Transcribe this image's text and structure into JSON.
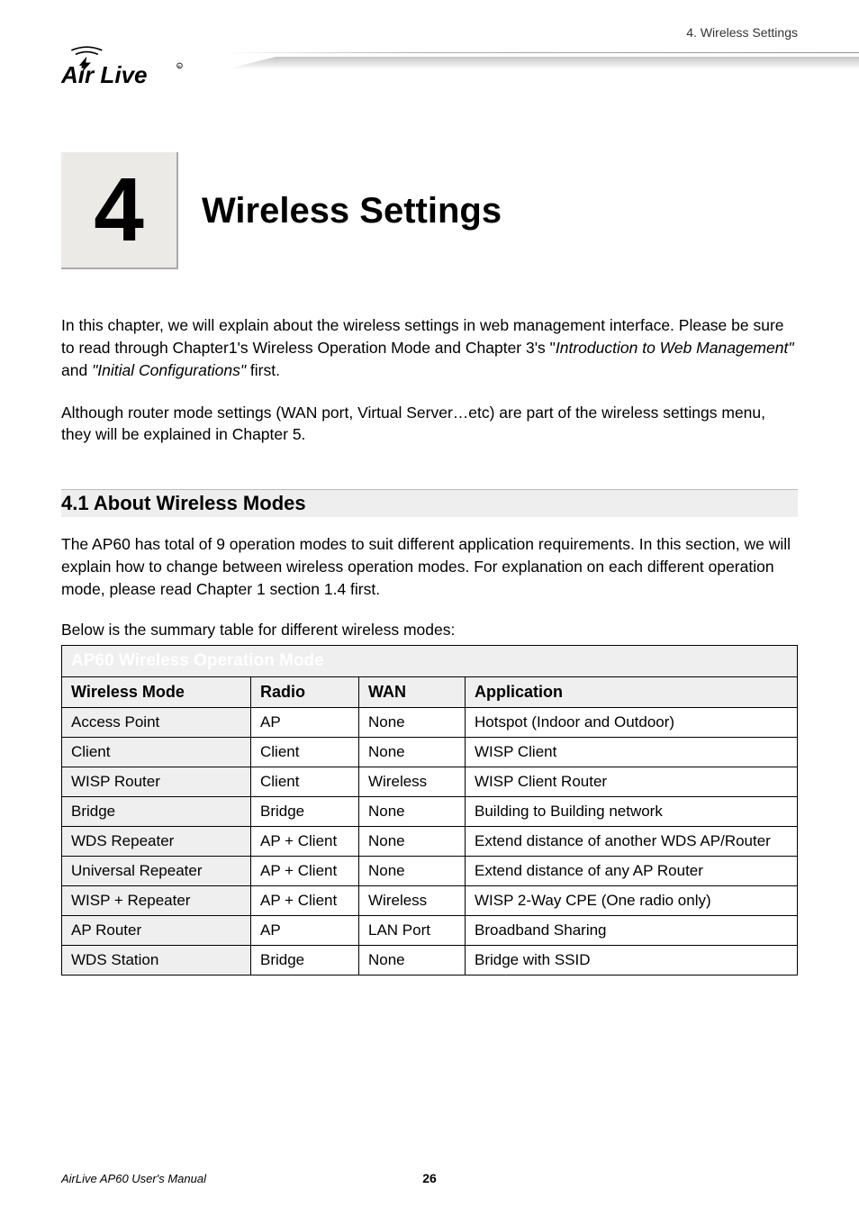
{
  "header": {
    "breadcrumb": "4. Wireless Settings",
    "logo_alt": "Air Live"
  },
  "chapter": {
    "number": "4",
    "title": "Wireless Settings"
  },
  "intro": {
    "p1_a": "In this chapter, we will explain about the wireless settings in web management interface. Please be sure to read through Chapter1's Wireless Operation Mode and Chapter 3's \"",
    "p1_i1": "Introduction to Web Management\"",
    "p1_b": " and ",
    "p1_i2": "\"Initial Configurations\"",
    "p1_c": " first.",
    "p2": "Although router mode settings (WAN port, Virtual Server…etc) are part of the wireless settings menu, they will be explained in Chapter 5."
  },
  "section": {
    "heading": "4.1 About Wireless Modes",
    "p1": "The AP60 has total of 9 operation modes to suit different application requirements.   In this section, we will explain how to change between wireless operation modes.   For explanation on each different operation mode, please read Chapter 1 section 1.4 first.",
    "table_caption": "Below is the summary table for different wireless modes:"
  },
  "table": {
    "title": "AP60 Wireless Operation Mode",
    "headers": {
      "mode": "Wireless Mode",
      "radio": "Radio",
      "wan": "WAN",
      "app": "Application"
    },
    "rows": [
      {
        "mode": "Access Point",
        "radio": "AP",
        "wan": "None",
        "app": "Hotspot (Indoor and Outdoor)"
      },
      {
        "mode": "Client",
        "radio": "Client",
        "wan": "None",
        "app": "WISP Client"
      },
      {
        "mode": "WISP Router",
        "radio": "Client",
        "wan": "Wireless",
        "app": "WISP Client Router"
      },
      {
        "mode": "Bridge",
        "radio": "Bridge",
        "wan": "None",
        "app": "Building to Building network"
      },
      {
        "mode": "WDS Repeater",
        "radio": "AP + Client",
        "wan": "None",
        "app": "Extend distance of another WDS AP/Router"
      },
      {
        "mode": "Universal Repeater",
        "radio": "AP + Client",
        "wan": "None",
        "app": "Extend distance of any AP Router"
      },
      {
        "mode": "WISP + Repeater",
        "radio": "AP + Client",
        "wan": "Wireless",
        "app": "WISP 2-Way CPE (One radio only)"
      },
      {
        "mode": "AP Router",
        "radio": "AP",
        "wan": "LAN Port",
        "app": "Broadband Sharing"
      },
      {
        "mode": "WDS Station",
        "radio": "Bridge",
        "wan": "None",
        "app": "Bridge with SSID"
      }
    ]
  },
  "footer": {
    "left": "AirLive AP60 User's Manual",
    "page": "26"
  }
}
